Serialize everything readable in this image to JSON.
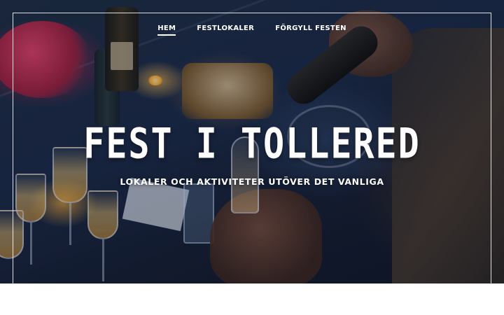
{
  "nav": {
    "items": [
      {
        "label": "HEM",
        "active": true
      },
      {
        "label": "FESTLOKALER",
        "active": false
      },
      {
        "label": "FÖRGYLL FESTEN",
        "active": false
      }
    ]
  },
  "hero": {
    "title": "FEST I TOLLERED",
    "subtitle": "LOKALER OCH AKTIVITETER UTÖVER DET VANLIGA",
    "image_description_icon": "party-table-photo"
  },
  "colors": {
    "text": "#ffffff",
    "hero_dark": "#1b2a48",
    "page_background": "#ffffff"
  }
}
